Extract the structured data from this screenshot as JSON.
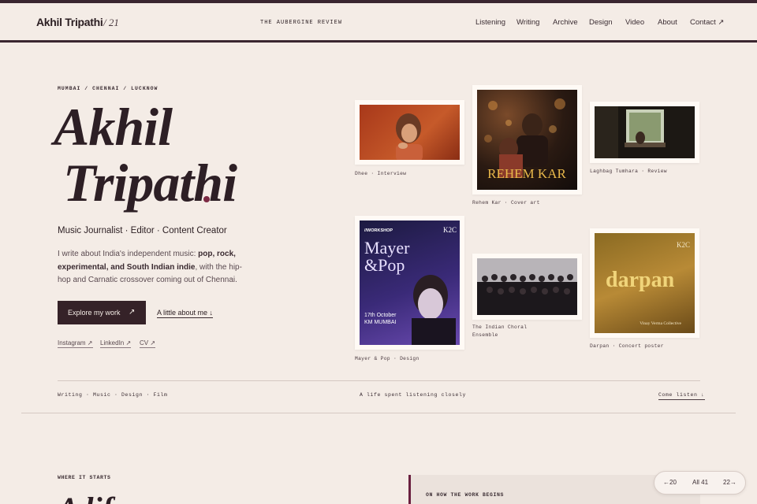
{
  "header": {
    "brand": "Akhil Tripathi",
    "issue": "/ 21",
    "publication": "THE AUBERGINE REVIEW",
    "nav": [
      "Listening",
      "Writing",
      "Archive",
      "Design",
      "Video",
      "About",
      "Contact ↗"
    ]
  },
  "hero": {
    "cities": "MUMBAI / CHENNAI / LUCKNOW",
    "name_line1": "Akhil",
    "name_line2": "Tripathi",
    "roles": "Music Journalist · Editor · Content Creator",
    "bio_intro": "I write about India's independent music: ",
    "bio_bold": "pop, rock, experimental, and South Indian indie",
    "bio_rest": ", with the hip-hop and Carnatic crossover coming out of Chennai.",
    "cta_primary": "Explore my work",
    "cta_primary_arrow": "↗",
    "cta_secondary": "A little about me ↓",
    "social": [
      "Instagram ↗",
      "LinkedIn ↗",
      "CV ↗"
    ]
  },
  "gallery": [
    {
      "caption": "Dhee · Interview"
    },
    {
      "caption": "Rehem Kar · Cover art",
      "art_text": "REHEM KAR"
    },
    {
      "caption": "Laghbag Tumhara · Review"
    },
    {
      "caption": "Mayer & Pop · Design",
      "art_tag": "//WORKSHOP",
      "art_title1": "Mayer",
      "art_title2": "&Pop",
      "art_date": "17th October",
      "art_place": "KM MUMBAI",
      "art_logo": "K2C"
    },
    {
      "caption": "The Indian Choral Ensemble"
    },
    {
      "caption": "Darpan · Concert poster",
      "art_text": "darpan",
      "art_logo": "K2C",
      "art_credit": "Vinay Verma Collective"
    }
  ],
  "strip": {
    "left": "Writing · Music · Design · Film",
    "middle": "A life spent listening closely",
    "right": "Come listen ↓"
  },
  "section": {
    "eyebrow": "WHERE IT STARTS",
    "heading": "A life ...",
    "panel_label": "ON HOW THE WORK BEGINS"
  },
  "pager": {
    "prev": "←20",
    "all": "All 41",
    "next": "22→"
  },
  "colors": {
    "background": "#f4ece6",
    "ink": "#2b1e22",
    "accent": "#7c2a44",
    "button": "#352228"
  }
}
